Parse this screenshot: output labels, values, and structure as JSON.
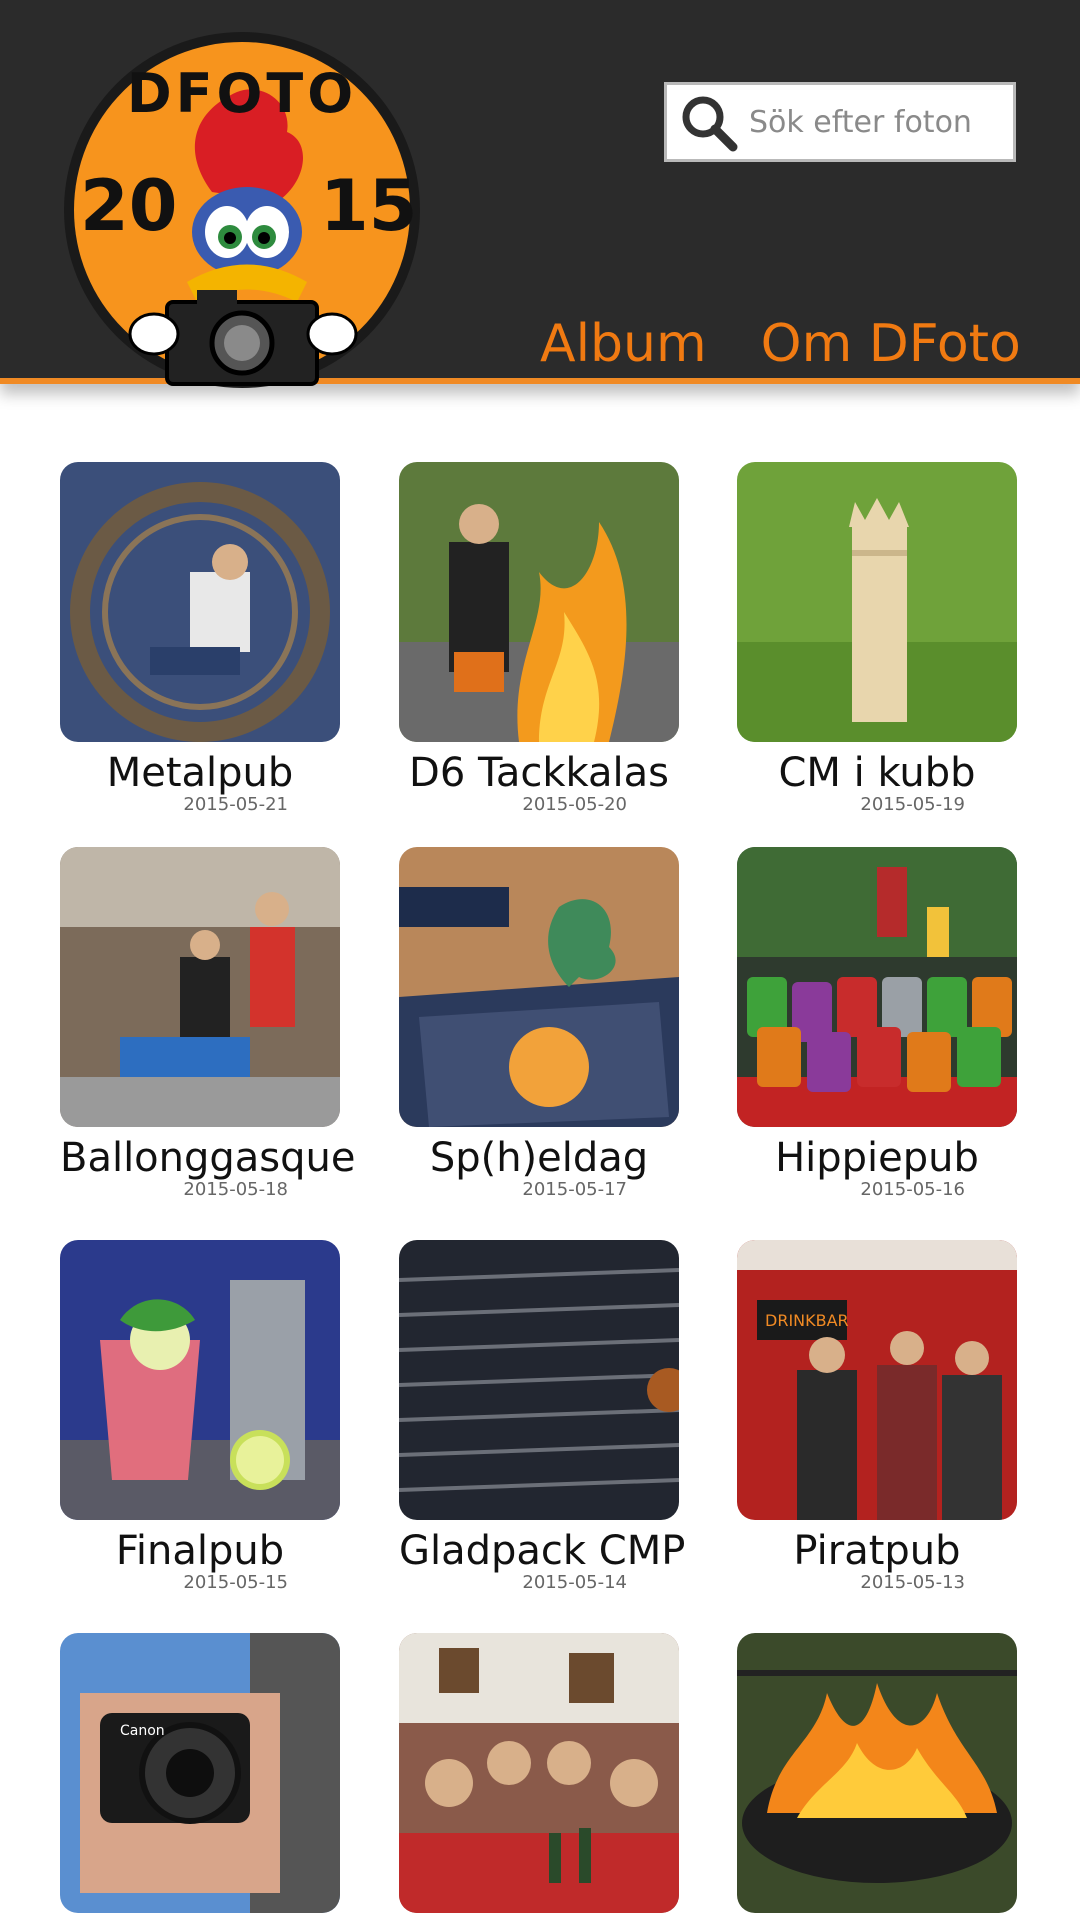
{
  "header": {
    "logo": {
      "top_text": "DFOTO",
      "year_left": "20",
      "year_right": "15",
      "colors": {
        "circle": "#f7941d",
        "ring": "#1a1a1a"
      }
    },
    "search": {
      "placeholder": "Sök efter foton",
      "icon": "search-icon"
    },
    "nav": [
      {
        "label": "Album"
      },
      {
        "label": "Om DFoto"
      }
    ],
    "colors": {
      "bar": "#2b2b2b",
      "accent": "#f08a24",
      "nav_text": "#f07a12"
    }
  },
  "albums": [
    {
      "title": "Metalpub",
      "date": "2015-05-21",
      "thumb": "monowheel-rider"
    },
    {
      "title": "D6 Tackkalas",
      "date": "2015-05-20",
      "thumb": "fire-breather"
    },
    {
      "title": "CM i kubb",
      "date": "2015-05-19",
      "thumb": "kubb-king-on-grass"
    },
    {
      "title": "Ballonggasque",
      "date": "2015-05-18",
      "thumb": "bar-staff"
    },
    {
      "title": "Sp(h)eldag",
      "date": "2015-05-17",
      "thumb": "board-game"
    },
    {
      "title": "Hippiepub",
      "date": "2015-05-16",
      "thumb": "soda-cans"
    },
    {
      "title": "Finalpub",
      "date": "2015-05-15",
      "thumb": "pink-drink"
    },
    {
      "title": "Gladpack CMP",
      "date": "2015-05-14",
      "thumb": "grill-grate"
    },
    {
      "title": "Piratpub",
      "date": "2015-05-13",
      "thumb": "drinkbar-crowd"
    },
    {
      "title": "",
      "date": "",
      "thumb": "camera-photographer"
    },
    {
      "title": "",
      "date": "",
      "thumb": "dinner-party"
    },
    {
      "title": "",
      "date": "",
      "thumb": "fire-pit"
    }
  ]
}
